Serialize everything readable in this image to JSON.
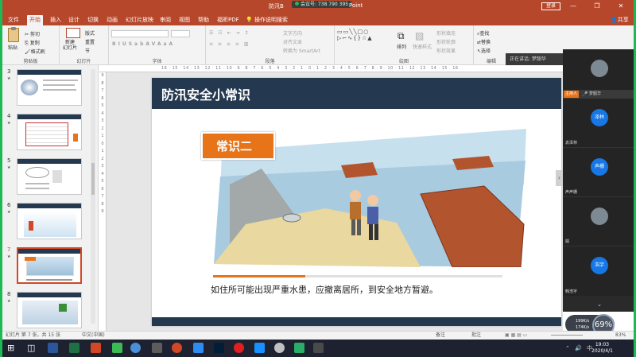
{
  "window": {
    "title": "防汛B",
    "title_suffix": "Point",
    "meeting_id": "会议号: 738 790 395",
    "signin_label": "登录",
    "min_glyph": "—",
    "restore_glyph": "❐",
    "close_glyph": "✕"
  },
  "tabs": [
    "文件",
    "开始",
    "插入",
    "设计",
    "切换",
    "动画",
    "幻灯片放映",
    "审阅",
    "视图",
    "帮助",
    "福昕PDF"
  ],
  "active_tab": "开始",
  "search_tip": "操作说明搜索",
  "share_label": "共享",
  "ribbon": {
    "clipboard": {
      "paste": "粘贴",
      "cut": "剪切",
      "copy": "复制",
      "format_painter": "格式刷",
      "label": "剪贴板"
    },
    "slides": {
      "new_slide": "新建\n幻灯片",
      "layout": "版式",
      "reset": "重置",
      "section": "节",
      "label": "幻灯片"
    },
    "font": {
      "label": "字体",
      "buttons": [
        "B",
        "I",
        "U",
        "S",
        "ab",
        "AV",
        "Aa",
        "A"
      ]
    },
    "paragraph": {
      "text_direction": "文字方向",
      "align_text": "对齐文本",
      "convert_smartart": "转换为 SmartArt",
      "label": "段落"
    },
    "drawing": {
      "arrange": "排列",
      "quick_styles": "快速样式",
      "fill": "形状填充",
      "outline": "形状轮廓",
      "effects": "形状效果",
      "label": "绘图"
    },
    "editing": {
      "find": "查找",
      "replace": "替换",
      "select": "选择",
      "label": "编辑"
    }
  },
  "thumbnails": [
    {
      "num": "3",
      "star": "★"
    },
    {
      "num": "4",
      "star": "★"
    },
    {
      "num": "5",
      "star": "★"
    },
    {
      "num": "6",
      "star": "★"
    },
    {
      "num": "7",
      "star": "★"
    },
    {
      "num": "8",
      "star": "★"
    }
  ],
  "ruler_h": "16 · 15 · 14 · 13 · 12 · 11 · 10 · 9 · 8 · 7 · 6 · 5 · 4 · 3 · 2 · 1 · 0 · 1 · 2 · 3 · 4 · 5 · 6 · 7 · 8 · 9 · 10 · 11 · 12 · 13 · 14 · 15 · 16",
  "slide": {
    "title": "防汛安全小常识",
    "tag": "常识二",
    "caption": "如住所可能出现严重水患，应撤离居所，到安全地方暂避。",
    "next_glyph": "›",
    "progress": 0.32
  },
  "meeting": {
    "speaking_label": "正在讲话: 梦韶华",
    "host_tag": "主持人",
    "host_name": "梦韶华",
    "participants": [
      {
        "avatar": "泽林",
        "name": "袁泽林",
        "photo": false
      },
      {
        "avatar": "声栅",
        "name": "声声栅",
        "photo": false
      },
      {
        "avatar": "",
        "name": "娟",
        "photo": true
      },
      {
        "avatar": "浩宇",
        "name": "韩浩宇",
        "photo": false
      }
    ],
    "collapse_glyph": "⌄"
  },
  "network": {
    "up": "199K/s",
    "down": "174K/s",
    "zoom": "69%"
  },
  "status": {
    "slide_info": "幻灯片 第 7 张，共 15 张",
    "language": "中文(中国)",
    "notes": "备注",
    "comments": "批注",
    "zoom": "83%"
  },
  "taskbar": {
    "time": "19:03",
    "date": "2020/4/1"
  },
  "colors": {
    "ppt_red": "#b7472a",
    "slide_navy": "#243950",
    "accent_orange": "#e8741a",
    "meeting_blue": "#1677e5"
  }
}
